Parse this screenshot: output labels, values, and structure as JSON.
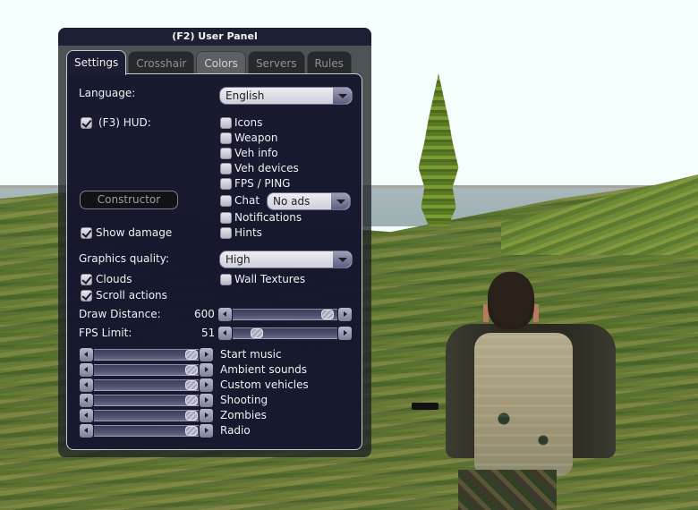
{
  "panel": {
    "title": "(F2) User Panel",
    "tabs": [
      {
        "label": "Settings",
        "active": true
      },
      {
        "label": "Crosshair",
        "active": false
      },
      {
        "label": "Colors",
        "active": false
      },
      {
        "label": "Servers",
        "active": false
      },
      {
        "label": "Rules",
        "active": false
      }
    ]
  },
  "settings": {
    "language_label": "Language:",
    "language_value": "English",
    "hud": {
      "label": "(F3) HUD:",
      "checked": true
    },
    "hud_options": [
      {
        "label": "Icons",
        "checked": false
      },
      {
        "label": "Weapon",
        "checked": false
      },
      {
        "label": "Veh info",
        "checked": false
      },
      {
        "label": "Veh devices",
        "checked": false
      },
      {
        "label": "FPS / PING",
        "checked": false
      },
      {
        "label": "Chat",
        "checked": false
      },
      {
        "label": "Notifications",
        "checked": false
      },
      {
        "label": "Hints",
        "checked": false
      }
    ],
    "chat_dropdown_value": "No ads",
    "constructor_label": "Constructor",
    "show_damage": {
      "label": "Show damage",
      "checked": true
    },
    "graphics_label": "Graphics quality:",
    "graphics_value": "High",
    "clouds": {
      "label": "Clouds",
      "checked": true
    },
    "scroll_actions": {
      "label": "Scroll actions",
      "checked": true
    },
    "wall_textures": {
      "label": "Wall Textures",
      "checked": false
    },
    "draw_distance": {
      "label": "Draw Distance:",
      "value": "600",
      "fraction": 0.97
    },
    "fps_limit": {
      "label": "FPS Limit:",
      "value": "51",
      "fraction": 0.2
    },
    "volumes": [
      {
        "label": "Start music",
        "fraction": 1.0
      },
      {
        "label": "Ambient sounds",
        "fraction": 1.0
      },
      {
        "label": "Custom vehicles",
        "fraction": 1.0
      },
      {
        "label": "Shooting",
        "fraction": 1.0
      },
      {
        "label": "Zombies",
        "fraction": 1.0
      },
      {
        "label": "Radio",
        "fraction": 1.0
      }
    ]
  }
}
